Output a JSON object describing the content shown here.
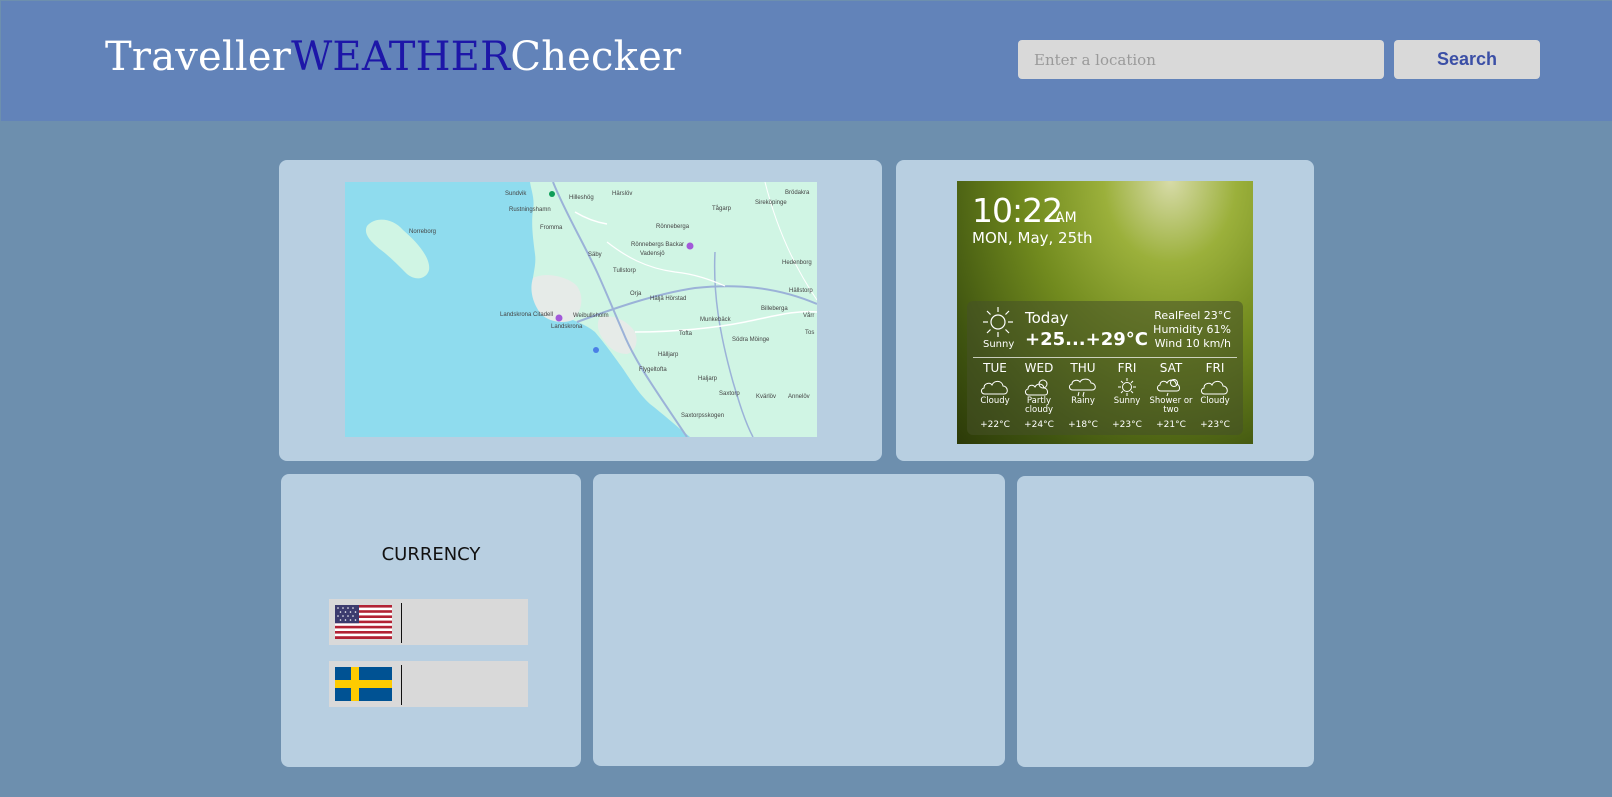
{
  "header": {
    "brand_part1": "Traveller",
    "brand_part2": "WEATHER",
    "brand_part3": "Checker",
    "search_placeholder": "Enter a location",
    "search_label": "Search"
  },
  "map": {
    "places": [
      "Sundvik",
      "Hilleshög",
      "Härslöv",
      "Brödakra",
      "Rustningshamn",
      "Tågarp",
      "Sireköpinge",
      "Norreborg",
      "Fromma",
      "Rönneberga",
      "Rönnebergs Backar",
      "Vadensjö",
      "Säby",
      "Hedenborg",
      "Tullstorp",
      "Orja",
      "Häljä Hörstad",
      "Billeberga",
      "Hällstorp",
      "Landskrona Citadell",
      "Weibullsholm",
      "Landskrona",
      "Munkebäck",
      "Vårr",
      "Tofta",
      "Södra Möinge",
      "Tos",
      "Hälljarp",
      "Flygeltofta",
      "Haljarp",
      "Saxtorp",
      "Kvärlöv",
      "Annelöv",
      "Saxtorpsskogen"
    ]
  },
  "weather": {
    "time": "10:22",
    "ampm": "AM",
    "date": "MON, May, 25th",
    "today_label": "Today",
    "today_temp": "+25...+29°C",
    "today_condition": "Sunny",
    "realfeel": "RealFeel 23°C",
    "humidity": "Humidity 61%",
    "wind": "Wind 10 km/h",
    "forecast": [
      {
        "day": "TUE",
        "condition": "Cloudy",
        "temp": "+22°C",
        "icon": "cloud-icon"
      },
      {
        "day": "WED",
        "condition": "Partly cloudy",
        "temp": "+24°C",
        "icon": "partly-cloudy-icon"
      },
      {
        "day": "THU",
        "condition": "Rainy",
        "temp": "+18°C",
        "icon": "rain-icon"
      },
      {
        "day": "FRI",
        "condition": "Sunny",
        "temp": "+23°C",
        "icon": "sun-icon"
      },
      {
        "day": "SAT",
        "condition": "Shower or two",
        "temp": "+21°C",
        "icon": "shower-icon"
      },
      {
        "day": "FRI",
        "condition": "Cloudy",
        "temp": "+23°C",
        "icon": "cloud-icon"
      }
    ]
  },
  "currency": {
    "title": "CURRENCY",
    "rows": [
      {
        "flag": "us-flag-icon",
        "value": ""
      },
      {
        "flag": "sweden-flag-icon",
        "value": ""
      }
    ]
  },
  "colors": {
    "page_bg": "#6d8fae",
    "header_bg": "#6283b9",
    "card_bg": "#b8cfe1",
    "brand_accent": "#1d16a8",
    "button_text": "#3b4fa6"
  }
}
